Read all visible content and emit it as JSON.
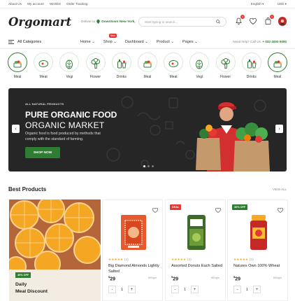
{
  "topbar": {
    "links": [
      "About Us",
      "My account",
      "Wishlist",
      "Order Tracking"
    ],
    "language": "English",
    "currency": "USD"
  },
  "header": {
    "logo": "Orgomart",
    "deliver_label": "Deliver to",
    "deliver_location": "Downtown New York,",
    "search_placeholder": "Start typing to search...",
    "notification_count": "1",
    "wishlist_count": "0",
    "cart_count": "1"
  },
  "nav": {
    "all_categories": "All Categories",
    "menu": [
      "Home",
      "Shop",
      "Dashboard",
      "Product",
      "Pages"
    ],
    "hot_label": "New",
    "help_label": "Need help? Call Us:",
    "phone": "+ 032 4000 5000"
  },
  "categories": [
    {
      "label": "Meal",
      "icon": "meal-icon",
      "active": true
    },
    {
      "label": "Meat",
      "icon": "meat-icon",
      "active": false
    },
    {
      "label": "Vegi",
      "icon": "vegetable-icon",
      "active": false
    },
    {
      "label": "Flower",
      "icon": "broccoli-icon",
      "active": false
    },
    {
      "label": "Drinks",
      "icon": "drinks-icon",
      "active": false
    },
    {
      "label": "Meal",
      "icon": "meal-icon",
      "active": false
    },
    {
      "label": "Meat",
      "icon": "meat-icon",
      "active": false
    },
    {
      "label": "Vegi",
      "icon": "vegetable-icon",
      "active": false
    },
    {
      "label": "Flower",
      "icon": "broccoli-icon",
      "active": false
    },
    {
      "label": "Drinks",
      "icon": "drinks-icon",
      "active": false
    },
    {
      "label": "Meal",
      "icon": "meal-icon",
      "active": true
    }
  ],
  "banner": {
    "eyebrow": "ALL NATURAL PRODUCTS",
    "title_line1": "PURE ORGANIC FOOD",
    "title_line2": "ORGANIC MARKET",
    "description": "Organic food is food produced by methods that comply with the standard of farming.",
    "button": "SHOP NOW"
  },
  "best_products": {
    "title": "Best Products",
    "view_all": "VIEW ALL",
    "promo": {
      "badge": "30% OFF",
      "line1": "Daily",
      "line2": "Meal Discount"
    },
    "items": [
      {
        "badge": "",
        "name": "Big Diamond Almonds Lightly Salted",
        "rating_count": "(4)",
        "price": "29",
        "currency": "$",
        "weight": "500gm",
        "qty": "1"
      },
      {
        "badge": "DEAL",
        "name": "Assorted Donuts Each Salted",
        "rating_count": "(4)",
        "price": "29",
        "currency": "$",
        "weight": "500gm",
        "qty": "1"
      },
      {
        "badge": "30% OFF",
        "name": "Natures Own 100% Wheat",
        "rating_count": "(4)",
        "price": "29",
        "currency": "$",
        "weight": "500gm",
        "qty": "1"
      }
    ]
  },
  "colors": {
    "primary": "#2e7d32",
    "deal": "#e53935",
    "banner_bg": "#262626",
    "star": "#f5a623"
  }
}
